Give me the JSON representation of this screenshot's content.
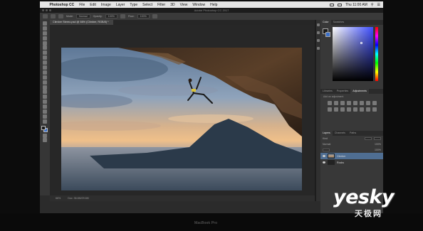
{
  "menubar": {
    "apple_glyph": "",
    "items": [
      "Photoshop CC",
      "File",
      "Edit",
      "Image",
      "Layer",
      "Type",
      "Select",
      "Filter",
      "3D",
      "View",
      "Window",
      "Help"
    ],
    "clock": "Thu 11:00 AM"
  },
  "window": {
    "title": "Adobe Photoshop CC 2017"
  },
  "options_bar": {
    "mode_label": "Mode:",
    "mode_value": "Normal",
    "opacity_label": "Opacity:",
    "opacity_value": "100%",
    "flow_label": "Flow:",
    "flow_value": "100%"
  },
  "document": {
    "tab_title": "Climber Stereo.psd @ 66% (Climber, RGB/8) *",
    "zoom": "66%",
    "doc_size": "Doc: 36.6M/29.6M"
  },
  "panels": {
    "color_tabs": [
      "Color",
      "Swatches"
    ],
    "adjust_tabs": [
      "Libraries",
      "Properties",
      "Adjustments"
    ],
    "adjust_hint": "Add an adjustment",
    "layers_tabs": [
      "Layers",
      "Channels",
      "Paths"
    ],
    "layers_kind": "Kind",
    "layers_blend": "Normal",
    "layers_opacity": "100%",
    "layers_fill": "100%",
    "layers": [
      {
        "name": "Climber"
      },
      {
        "name": "Rocks"
      }
    ]
  },
  "laptop_label": "MacBook Pro",
  "watermark": {
    "main": "yesky",
    "sub": "天极网"
  }
}
